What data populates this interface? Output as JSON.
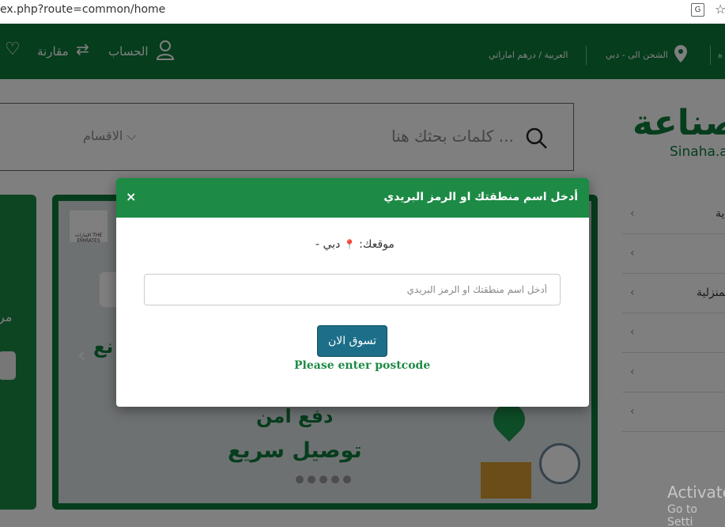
{
  "browser": {
    "url": "ex.php?route=common/home",
    "translate_icon": "google-translate-icon",
    "star_icon": "star-outline-icon"
  },
  "header": {
    "wishlist_icon": "heart-icon",
    "compare_label": "مقارنة",
    "compare_icon": "arrows-swap-icon",
    "account_label": "الحساب",
    "account_icon": "user-icon",
    "language_currency": "العربية / درهم اماراتي",
    "shipping_label": "الشحن الى - دبي",
    "location_icon": "map-pin-icon",
    "edge_label": "ه"
  },
  "search": {
    "placeholder": "كلمات بحثك هنا ...",
    "categories_label": "الاقسام"
  },
  "logo": {
    "text": "صناعة",
    "sub": "Sinaha.ae"
  },
  "banner": {
    "emblem_text": "الإمارات THE EMIRATES",
    "pay_text": "دفع امن",
    "delivery_text": "توصيل سريع",
    "tag_text": "نع",
    "side_text": "مر"
  },
  "menu": {
    "items": [
      "ية",
      "",
      "المنزلية",
      "",
      "",
      ""
    ]
  },
  "modal": {
    "title": "أدخل اسم منطقتك او الرمز البريدي",
    "close": "×",
    "location_label": "موقعك:",
    "location_value": "دبي -",
    "postcode_placeholder": "أدخل اسم منطقتك او الرمز البريدي",
    "shop_button": "تسوق الان",
    "error": "Please enter postcode"
  },
  "watermark": {
    "line1": "Activate",
    "line2": "Go to Setti"
  },
  "colors": {
    "brand_green": "#0c7a3b",
    "modal_header": "#1d8a45",
    "button_teal": "#1d6e88"
  }
}
